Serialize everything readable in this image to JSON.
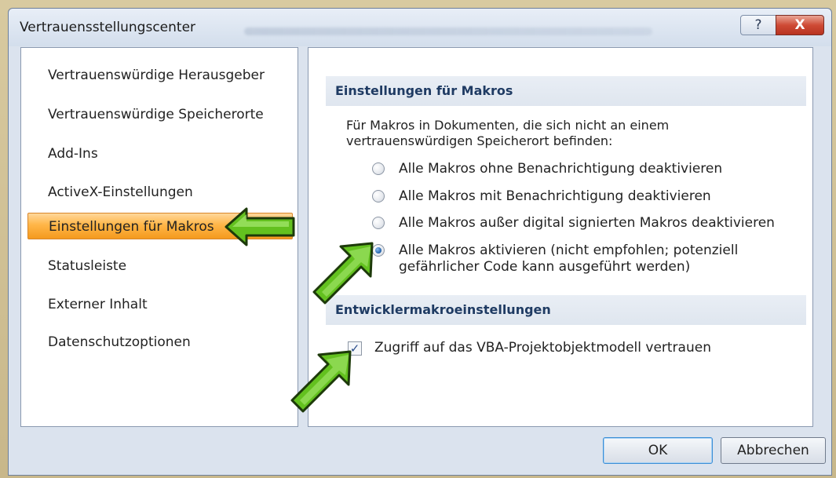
{
  "window": {
    "title": "Vertrauensstellungscenter",
    "help_label": "?",
    "close_label": "X"
  },
  "nav": {
    "items": [
      {
        "label": "Vertrauenswürdige Herausgeber"
      },
      {
        "label": "Vertrauenswürdige Speicherorte"
      },
      {
        "label": "Add-Ins"
      },
      {
        "label": "ActiveX-Einstellungen"
      },
      {
        "label": "Einstellungen für Makros"
      },
      {
        "label": "Statusleiste"
      },
      {
        "label": "Externer Inhalt"
      },
      {
        "label": "Datenschutzoptionen"
      }
    ],
    "selected": "Einstellungen für Makros"
  },
  "macro_settings": {
    "header": "Einstellungen für Makros",
    "description_line1": "Für Makros in Dokumenten, die sich nicht an einem",
    "description_line2": "vertrauenswürdigen Speicherort befinden:",
    "options": [
      {
        "label": "Alle Makros ohne Benachrichtigung deaktivieren",
        "selected": false
      },
      {
        "label": "Alle Makros mit Benachrichtigung deaktivieren",
        "selected": false
      },
      {
        "label": "Alle Makros außer digital signierten Makros deaktivieren",
        "selected": false
      },
      {
        "label_line1": "Alle Makros aktivieren (nicht empfohlen; potenziell",
        "label_line2": "gefährlicher Code kann ausgeführt werden)",
        "selected": true
      }
    ]
  },
  "developer_settings": {
    "header": "Entwicklermakroeinstellungen",
    "checkbox_label": "Zugriff auf das VBA-Projektobjektmodell vertrauen",
    "checked": true
  },
  "buttons": {
    "ok": "OK",
    "cancel": "Abbrechen"
  },
  "colors": {
    "accent_selected": "#ffb648",
    "arrow_green": "#5cbf1e",
    "header_text": "#1f3b63"
  }
}
